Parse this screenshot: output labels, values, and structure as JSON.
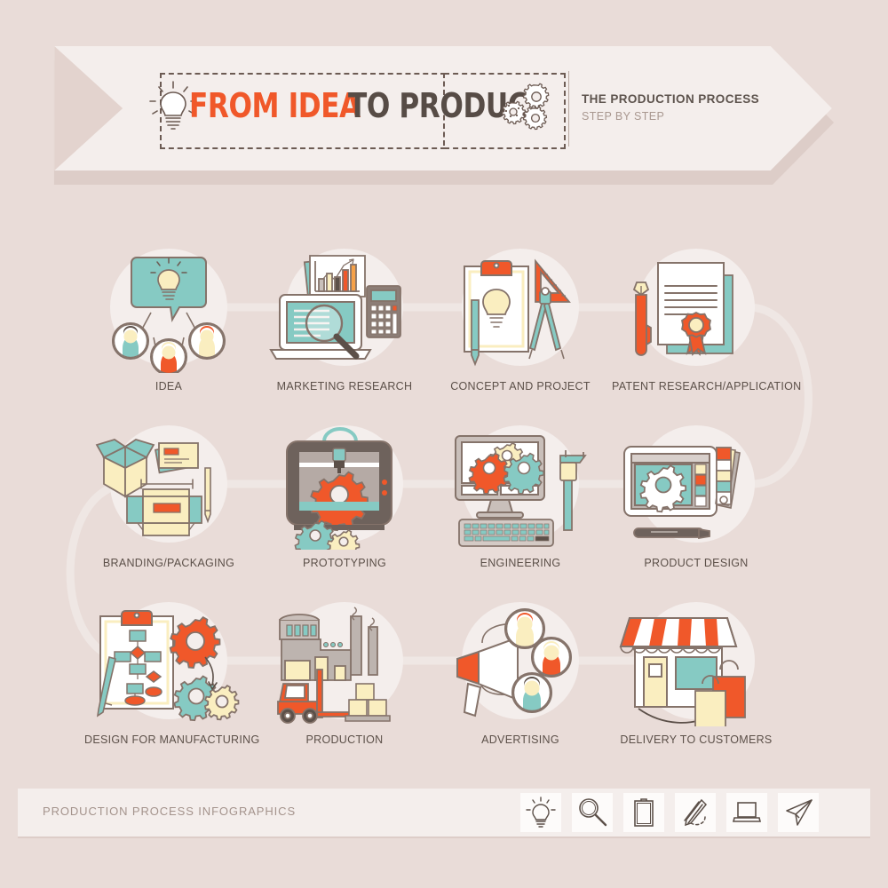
{
  "page": {
    "background_color": "#e9dcd8",
    "panel_color": "#f4eeec",
    "accent_orange": "#f0582a",
    "accent_teal": "#86cac3",
    "accent_cream": "#faeec0",
    "ink": "#6c5b53"
  },
  "header": {
    "bulb_icon": "lightbulb-icon",
    "title_part1": "FROM IDEA",
    "title_part2": "TO PRODUCT",
    "gears_icon": "gears-icon",
    "subtitle": "THE PRODUCTION PROCESS",
    "subtitle_secondary": "STEP BY STEP"
  },
  "steps": [
    {
      "label": "IDEA",
      "icon": "idea-team-lightbulb-icon"
    },
    {
      "label": "MARKETING RESEARCH",
      "icon": "laptop-chart-calculator-icon"
    },
    {
      "label": "CONCEPT AND PROJECT",
      "icon": "clipboard-lightbulb-ruler-icon"
    },
    {
      "label": "PATENT RESEARCH/APPLICATION",
      "icon": "certificate-pen-icon"
    },
    {
      "label": "BRANDING/PACKAGING",
      "icon": "box-packaging-icon"
    },
    {
      "label": "PROTOTYPING",
      "icon": "3d-printer-gear-icon"
    },
    {
      "label": "ENGINEERING",
      "icon": "desktop-gears-caliper-icon"
    },
    {
      "label": "PRODUCT DESIGN",
      "icon": "tablet-swatches-stylus-icon"
    },
    {
      "label": "DESIGN FOR MANUFACTURING",
      "icon": "flowchart-clipboard-gears-icon"
    },
    {
      "label": "PRODUCTION",
      "icon": "factory-forklift-icon"
    },
    {
      "label": "ADVERTISING",
      "icon": "megaphone-people-icon"
    },
    {
      "label": "DELIVERY TO CUSTOMERS",
      "icon": "shop-shopping-bags-icon"
    }
  ],
  "footer": {
    "caption": "PRODUCTION PROCESS INFOGRAPHICS",
    "icons": [
      "lightbulb-icon",
      "magnifier-icon",
      "clipboard-icon",
      "pencil-icon",
      "laptop-icon",
      "paper-plane-icon"
    ]
  }
}
